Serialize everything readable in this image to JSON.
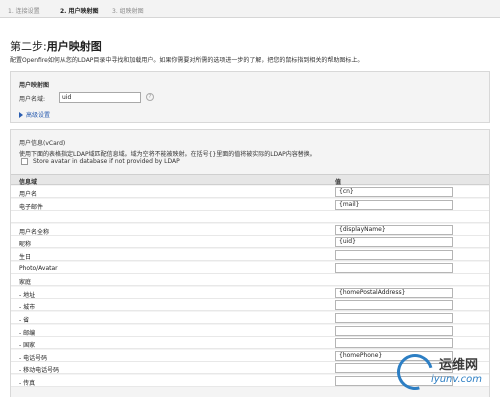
{
  "steps": [
    {
      "label": "1. 连接设置"
    },
    {
      "label": "2. 用户映射图"
    },
    {
      "label": "3. 组映射图"
    }
  ],
  "page": {
    "title_prefix": "第二步:",
    "title_suffix": "用户映射图",
    "description": "配置Openfire如何从您的LDAP目录中寻找和加载用户。如果你需要对所需的选项进一步的了解，把您的鼠标指到相关的帮助图标上。"
  },
  "user_mapping": {
    "heading": "用户映射图",
    "username_label": "用户名域:",
    "username_value": "uid",
    "help_icon": "?",
    "advanced_link": "高级设置"
  },
  "vcard": {
    "heading": "用户信息(vCard)",
    "description": "使用下面的表格指定LDAP域匹配信息域。域为空将不能被映射。在括号{}里面的值将被实际的LDAP内容替换。",
    "checkbox_label": "Store avatar in database if not provided by LDAP",
    "col_field": "信息域",
    "col_value": "值",
    "rows": [
      {
        "label": "用户名",
        "value": "{cn}",
        "has_input": true
      },
      {
        "label": "电子邮件",
        "value": "{mail}",
        "has_input": true
      },
      {
        "label": "",
        "value": "",
        "has_input": false
      },
      {
        "label": "用户名全称",
        "value": "{displayName}",
        "has_input": true
      },
      {
        "label": "昵称",
        "value": "{uid}",
        "has_input": true
      },
      {
        "label": "生日",
        "value": "",
        "has_input": true
      },
      {
        "label": "Photo/Avatar",
        "value": "",
        "has_input": true
      },
      {
        "label": "家庭",
        "value": "",
        "has_input": false
      },
      {
        "label": "- 地址",
        "value": "{homePostalAddress}",
        "has_input": true
      },
      {
        "label": "- 城市",
        "value": "",
        "has_input": true
      },
      {
        "label": "- 省",
        "value": "",
        "has_input": true
      },
      {
        "label": "- 邮编",
        "value": "",
        "has_input": true
      },
      {
        "label": "- 国家",
        "value": "",
        "has_input": true
      },
      {
        "label": "- 电话号码",
        "value": "{homePhone}",
        "has_input": true
      },
      {
        "label": "- 移动电话号码",
        "value": "",
        "has_input": true
      },
      {
        "label": "- 传真",
        "value": "",
        "has_input": true
      }
    ]
  },
  "watermark": {
    "text1": "运维网",
    "text2": "iyunv.com"
  }
}
